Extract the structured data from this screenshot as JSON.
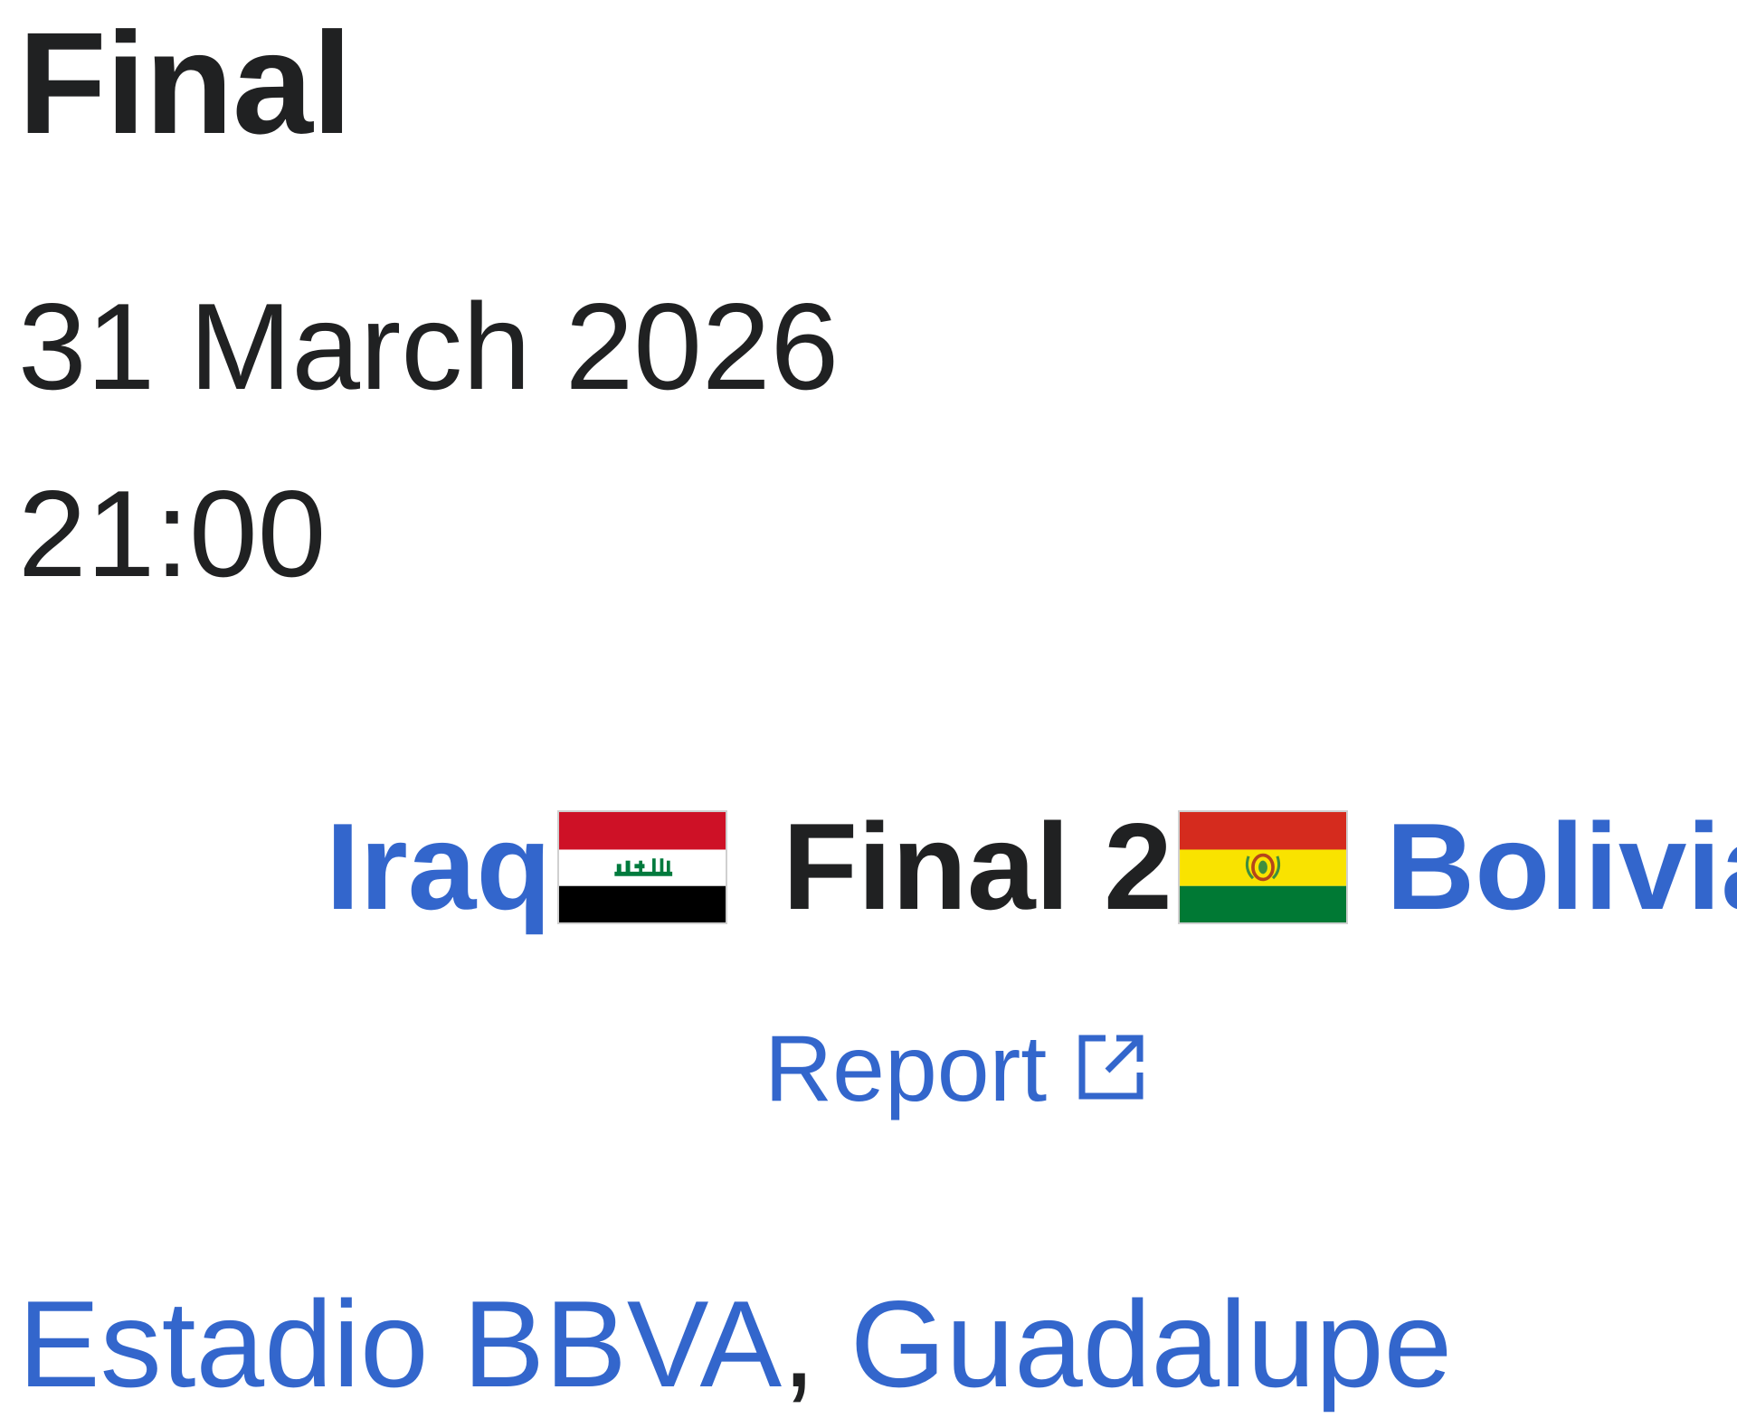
{
  "heading": "Final",
  "date": "31 March 2026",
  "time": "21:00",
  "match": {
    "home_team": "Iraq",
    "away_team": "Bolivia",
    "score": "Final 2",
    "home_flag": "iraq-flag-icon",
    "away_flag": "bolivia-flag-icon"
  },
  "report": {
    "label": "Report",
    "icon": "external-link-icon"
  },
  "venue": {
    "stadium": "Estadio BBVA",
    "separator": ",",
    "city": "Guadalupe"
  },
  "colors": {
    "link": "#3366cc",
    "text": "#202122"
  }
}
